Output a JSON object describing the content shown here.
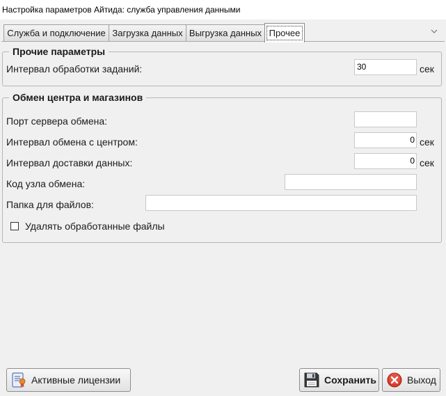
{
  "window": {
    "title": "Настройка параметров Айтида: служба управления данными"
  },
  "tabs": [
    {
      "label": "Служба и подключение"
    },
    {
      "label": "Загрузка данных"
    },
    {
      "label": "Выгрузка данных"
    },
    {
      "label": "Прочее"
    }
  ],
  "other_params": {
    "legend": "Прочие параметры",
    "task_interval_label": "Интервал обработки заданий:",
    "task_interval_value": "30",
    "task_interval_unit": "сек"
  },
  "exchange": {
    "legend": "Обмен центра и магазинов",
    "port_label": "Порт сервера обмена:",
    "port_value": "",
    "center_interval_label": "Интервал обмена с центром:",
    "center_interval_value": "0",
    "center_interval_unit": "сек",
    "delivery_interval_label": "Интервал доставки данных:",
    "delivery_interval_value": "0",
    "delivery_interval_unit": "сек",
    "node_code_label": "Код узла обмена:",
    "node_code_value": "",
    "folder_label": "Папка для файлов:",
    "folder_value": "",
    "delete_files_label": "Удалять обработанные файлы",
    "delete_files_checked": false
  },
  "buttons": {
    "licenses": "Активные лицензии",
    "save": "Сохранить",
    "exit": "Выход"
  },
  "icons": {
    "licenses": "license-document-icon",
    "save": "floppy-disk-icon",
    "exit": "close-circle-icon",
    "tab_overflow": "chevron-down-icon"
  },
  "colors": {
    "background": "#f0f0f0",
    "exit_icon": "#d93a2b",
    "save_icon": "#3a3a3a"
  }
}
